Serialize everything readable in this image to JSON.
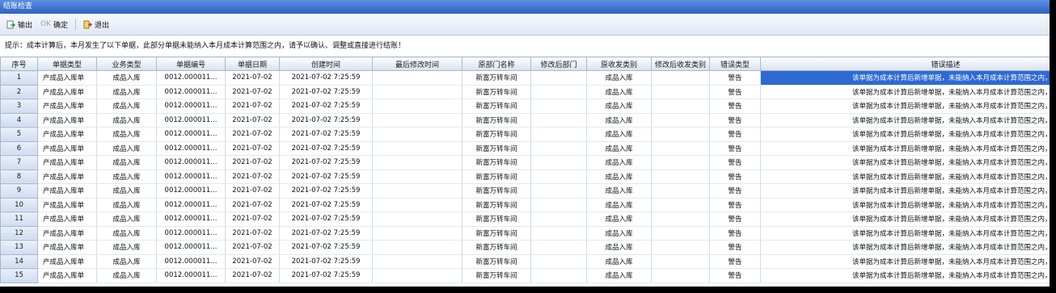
{
  "window": {
    "title": "结账检查"
  },
  "toolbar": {
    "export_label": "输出",
    "ok_prefix": "OK",
    "ok_label": "确定",
    "exit_label": "退出"
  },
  "hint": "提示：成本计算后，本月发生了以下单据，此部分单据未能纳入本月成本计算范围之内，请予以确认、调整或直接进行结账！",
  "grid": {
    "columns": [
      "序号",
      "单据类型",
      "业务类型",
      "单据编号",
      "单据日期",
      "创建时间",
      "最后修改时间",
      "原部门名称",
      "修改后部门",
      "原收发类别",
      "修改后收发类别",
      "错误类型",
      "错误描述"
    ],
    "rows": [
      [
        "1",
        "产成品入库单",
        "成品入库",
        "0012.000011...",
        "2021-07-02",
        "2021-07-02  7:25:59",
        "",
        "新富万转车间",
        "",
        "成品入库",
        "",
        "警告",
        "该单据为成本计算后新增单据，未能纳入本月成本计算范围之内，请确认调整或直接结账。"
      ],
      [
        "2",
        "产成品入库单",
        "成品入库",
        "0012.000011...",
        "2021-07-02",
        "2021-07-02  7:25:59",
        "",
        "新富万转车间",
        "",
        "成品入库",
        "",
        "警告",
        "该单据为成本计算后新增单据，未能纳入本月成本计算范围之内，请确认调整或直接结账。"
      ],
      [
        "3",
        "产成品入库单",
        "成品入库",
        "0012.000011...",
        "2021-07-02",
        "2021-07-02  7:25:59",
        "",
        "新富万转车间",
        "",
        "成品入库",
        "",
        "警告",
        "该单据为成本计算后新增单据，未能纳入本月成本计算范围之内，请确认调整或直接结账。"
      ],
      [
        "4",
        "产成品入库单",
        "成品入库",
        "0012.000011...",
        "2021-07-02",
        "2021-07-02  7:25:59",
        "",
        "新富万转车间",
        "",
        "成品入库",
        "",
        "警告",
        "该单据为成本计算后新增单据，未能纳入本月成本计算范围之内，请确认调整或直接结账。"
      ],
      [
        "5",
        "产成品入库单",
        "成品入库",
        "0012.000011...",
        "2021-07-02",
        "2021-07-02  7:25:59",
        "",
        "新富万转车间",
        "",
        "成品入库",
        "",
        "警告",
        "该单据为成本计算后新增单据，未能纳入本月成本计算范围之内，请确认调整或直接结账。"
      ],
      [
        "6",
        "产成品入库单",
        "成品入库",
        "0012.000011...",
        "2021-07-02",
        "2021-07-02  7:25:59",
        "",
        "新富万转车间",
        "",
        "成品入库",
        "",
        "警告",
        "该单据为成本计算后新增单据，未能纳入本月成本计算范围之内，请确认调整或直接结账。"
      ],
      [
        "7",
        "产成品入库单",
        "成品入库",
        "0012.000011...",
        "2021-07-02",
        "2021-07-02  7:25:59",
        "",
        "新富万转车间",
        "",
        "成品入库",
        "",
        "警告",
        "该单据为成本计算后新增单据，未能纳入本月成本计算范围之内，请确认调整或直接结账。"
      ],
      [
        "8",
        "产成品入库单",
        "成品入库",
        "0012.000011...",
        "2021-07-02",
        "2021-07-02  7:25:59",
        "",
        "新富万转车间",
        "",
        "成品入库",
        "",
        "警告",
        "该单据为成本计算后新增单据，未能纳入本月成本计算范围之内，请确认调整或直接结账。"
      ],
      [
        "9",
        "产成品入库单",
        "成品入库",
        "0012.000011...",
        "2021-07-02",
        "2021-07-02  7:25:59",
        "",
        "新富万转车间",
        "",
        "成品入库",
        "",
        "警告",
        "该单据为成本计算后新增单据，未能纳入本月成本计算范围之内，请确认调整或直接结账。"
      ],
      [
        "10",
        "产成品入库单",
        "成品入库",
        "0012.000011...",
        "2021-07-02",
        "2021-07-02  7:25:59",
        "",
        "新富万转车间",
        "",
        "成品入库",
        "",
        "警告",
        "该单据为成本计算后新增单据，未能纳入本月成本计算范围之内，请确认调整或直接结账。"
      ],
      [
        "11",
        "产成品入库单",
        "成品入库",
        "0012.000011...",
        "2021-07-02",
        "2021-07-02  7:25:59",
        "",
        "新富万转车间",
        "",
        "成品入库",
        "",
        "警告",
        "该单据为成本计算后新增单据，未能纳入本月成本计算范围之内，请确认调整或直接结账。"
      ],
      [
        "12",
        "产成品入库单",
        "成品入库",
        "0012.000011...",
        "2021-07-02",
        "2021-07-02  7:25:59",
        "",
        "新富万转车间",
        "",
        "成品入库",
        "",
        "警告",
        "该单据为成本计算后新增单据，未能纳入本月成本计算范围之内，请确认调整或直接结账。"
      ],
      [
        "13",
        "产成品入库单",
        "成品入库",
        "0012.000011...",
        "2021-07-02",
        "2021-07-02  7:25:59",
        "",
        "新富万转车间",
        "",
        "成品入库",
        "",
        "警告",
        "该单据为成本计算后新增单据，未能纳入本月成本计算范围之内，请确认调整或直接结账。"
      ],
      [
        "14",
        "产成品入库单",
        "成品入库",
        "0012.000011...",
        "2021-07-02",
        "2021-07-02  7:25:59",
        "",
        "新富万转车间",
        "",
        "成品入库",
        "",
        "警告",
        "该单据为成本计算后新增单据，未能纳入本月成本计算范围之内，请确认调整或直接结账。"
      ],
      [
        "15",
        "产成品入库单",
        "成品入库",
        "0012.000011...",
        "2021-07-02",
        "2021-07-02  7:25:59",
        "",
        "新富万转车间",
        "",
        "成品入库",
        "",
        "警告",
        "该单据为成本计算后新增单据，未能纳入本月成本计算范围之内，请确认调整或直接结账。"
      ]
    ]
  },
  "colors": {
    "title_bar": "#2f62c4",
    "selection": "#2f6ad1"
  }
}
